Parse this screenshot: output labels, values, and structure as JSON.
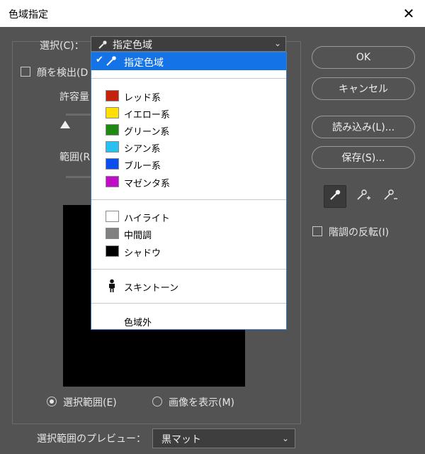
{
  "dialog": {
    "title": "色域指定",
    "close_glyph": "✕"
  },
  "select_control": {
    "label": "選択(C)：",
    "value": "指定色域",
    "icon": "eyedropper-icon"
  },
  "face_detect": {
    "label": "顔を検出(D",
    "checked": false
  },
  "tolerance": {
    "label": "許容量",
    "level": 0.0
  },
  "range": {
    "label": "範囲(R",
    "level": 0.0
  },
  "display": {
    "options": [
      {
        "label": "選択範囲(E)",
        "selected": true
      },
      {
        "label": "画像を表示(M)",
        "selected": false
      }
    ]
  },
  "preview_select": {
    "label": "選択範囲のプレビュー：",
    "value": "黒マット"
  },
  "buttons": {
    "ok": "OK",
    "cancel": "キャンセル",
    "load": "読み込み(L)...",
    "save": "保存(S)..."
  },
  "tools": [
    "eyedropper-icon",
    "eyedropper-plus-icon",
    "eyedropper-minus-icon"
  ],
  "invert": {
    "label": "階調の反転(I)",
    "checked": false
  },
  "dropdown": {
    "selected": {
      "check": "✔",
      "label": "指定色域"
    },
    "colors": [
      {
        "label": "レッド系",
        "swatch": "#c4220b"
      },
      {
        "label": "イエロー系",
        "swatch": "#ffe000"
      },
      {
        "label": "グリーン系",
        "swatch": "#1f8a12"
      },
      {
        "label": "シアン系",
        "swatch": "#26c0f2"
      },
      {
        "label": "ブルー系",
        "swatch": "#0b4ef0"
      },
      {
        "label": "マゼンタ系",
        "swatch": "#c00dc8"
      }
    ],
    "tones": [
      {
        "label": "ハイライト",
        "swatch": "#ffffff"
      },
      {
        "label": "中間調",
        "swatch": "#808080"
      },
      {
        "label": "シャドウ",
        "swatch": "#000000"
      }
    ],
    "skin": {
      "label": "スキントーン",
      "icon": "person-icon"
    },
    "out_of_gamut": {
      "label": "色域外"
    }
  },
  "colors": {
    "accent": "#1473e6",
    "dialog_bg": "#535353",
    "field_bg": "#3e3e3e"
  }
}
